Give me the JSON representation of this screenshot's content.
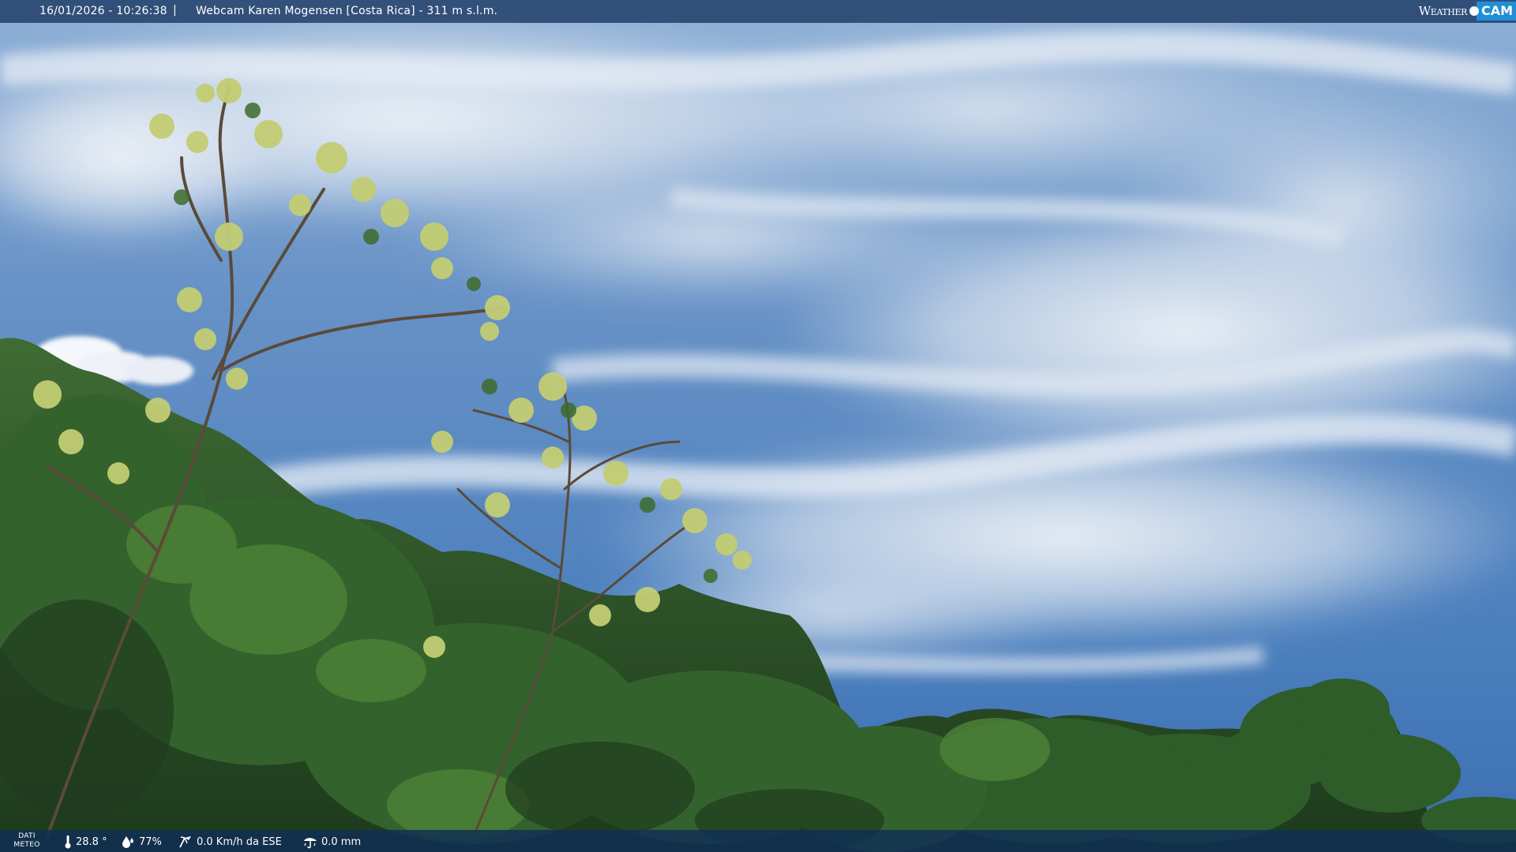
{
  "header": {
    "datetime": "16/01/2026 - 10:26:38",
    "separator": "|",
    "title": "Webcam Karen Mogensen [Costa Rica] - 311 m s.l.m."
  },
  "brand": {
    "weather": "Weather",
    "cam": "CAM"
  },
  "footer": {
    "dati_meteo_line1": "DATI",
    "dati_meteo_line2": "METEO",
    "temperature": "28.8 °",
    "humidity": "77%",
    "wind": "0.0 Km/h da ESE",
    "rain": "0.0 mm"
  },
  "icons": {
    "temperature": "thermometer-icon",
    "humidity": "humidity-drop-icon",
    "wind": "wind-icon",
    "rain": "rain-icon"
  },
  "colors": {
    "sky_top": "#5f8cc4",
    "sky_bottom": "#3d74b8",
    "vegetation": "#2f5a2a",
    "leaf_highlight": "#c8d27a",
    "topbar": "#24426c",
    "bottombar": "#102e56",
    "brand_accent": "#1f8ed6"
  }
}
